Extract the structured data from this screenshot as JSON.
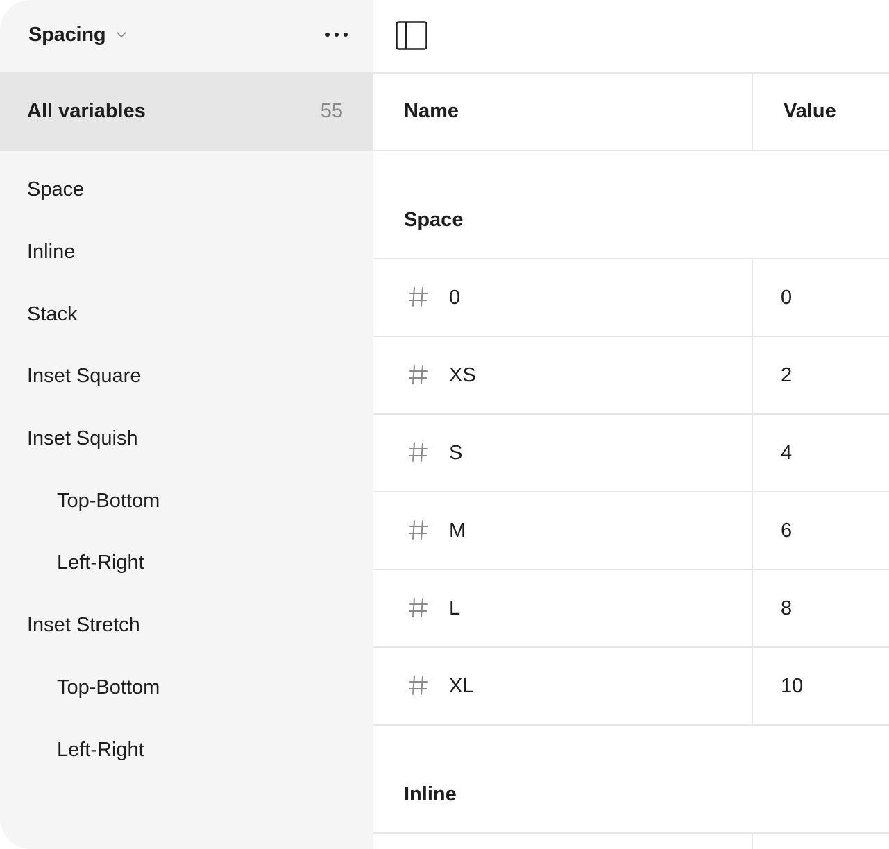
{
  "sidebar": {
    "collection": {
      "name": "Spacing"
    },
    "all_variables": {
      "label": "All variables",
      "count": "55"
    },
    "groups": [
      {
        "label": "Space",
        "level": 0
      },
      {
        "label": "Inline",
        "level": 0
      },
      {
        "label": "Stack",
        "level": 0
      },
      {
        "label": "Inset Square",
        "level": 0
      },
      {
        "label": "Inset Squish",
        "level": 0
      },
      {
        "label": "Top-Bottom",
        "level": 1
      },
      {
        "label": "Left-Right",
        "level": 1
      },
      {
        "label": "Inset Stretch",
        "level": 0
      },
      {
        "label": "Top-Bottom",
        "level": 1
      },
      {
        "label": "Left-Right",
        "level": 1
      }
    ]
  },
  "table": {
    "columns": {
      "name": "Name",
      "value": "Value"
    },
    "sections": [
      {
        "title": "Space",
        "rows": [
          {
            "icon": "number-variable-icon",
            "name": "0",
            "value": "0"
          },
          {
            "icon": "number-variable-icon",
            "name": "XS",
            "value": "2"
          },
          {
            "icon": "number-variable-icon",
            "name": "S",
            "value": "4"
          },
          {
            "icon": "number-variable-icon",
            "name": "M",
            "value": "6"
          },
          {
            "icon": "number-variable-icon",
            "name": "L",
            "value": "8"
          },
          {
            "icon": "number-variable-icon",
            "name": "XL",
            "value": "10"
          }
        ]
      },
      {
        "title": "Inline",
        "rows": []
      }
    ]
  },
  "icons": {
    "collection_dropdown": "chevron-down-icon",
    "more": "more-horizontal-icon",
    "sidebar_toggle": "sidebar-panel-icon"
  },
  "colors": {
    "sidebar_bg": "#f5f5f5",
    "selected_bg": "#e6e6e6",
    "divider": "#e6e6e6",
    "text": "#1e1e1e",
    "muted": "#8a8a8a"
  }
}
